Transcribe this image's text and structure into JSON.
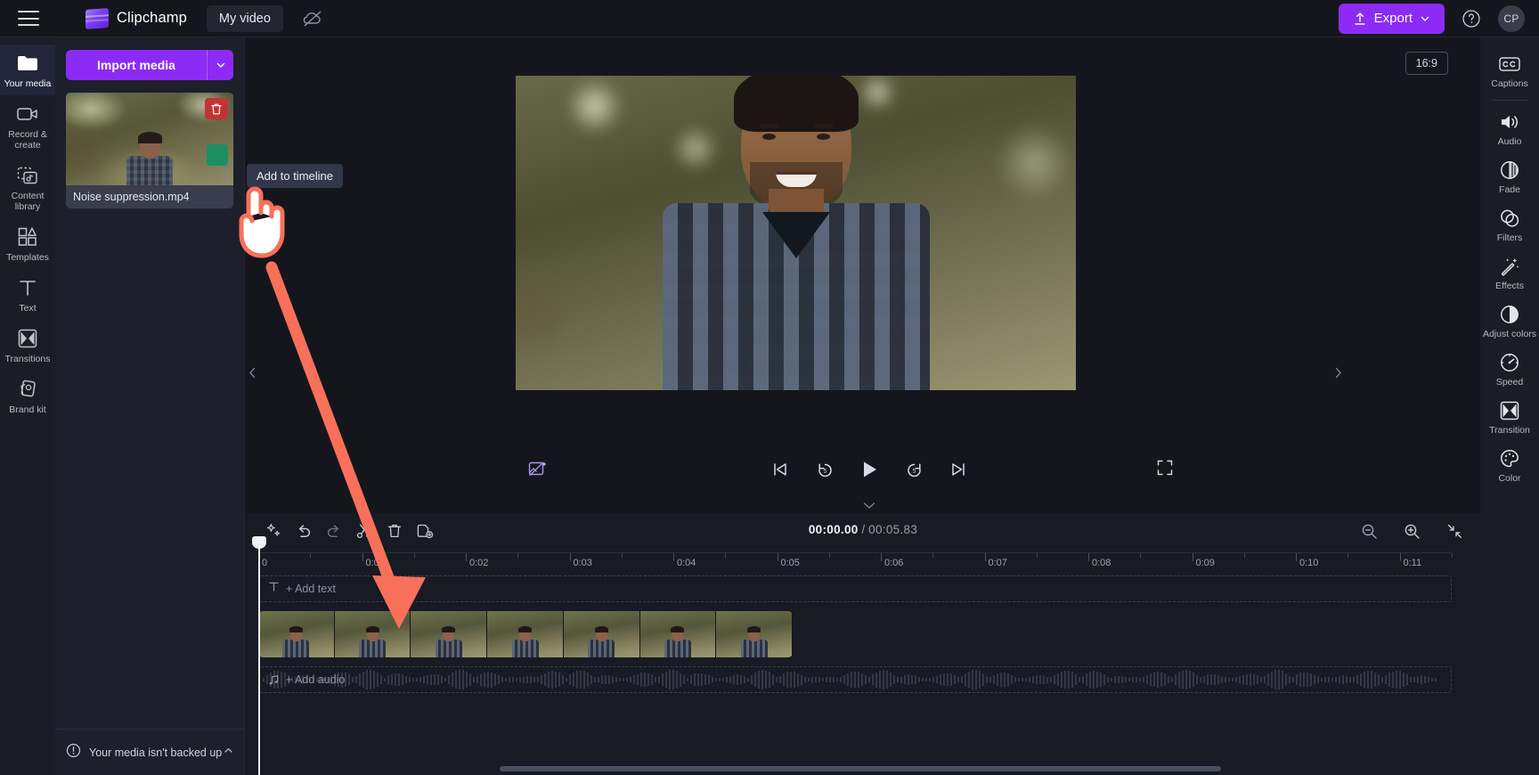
{
  "app": {
    "name": "Clipchamp",
    "project_title": "My video"
  },
  "header": {
    "menu_icon": "hamburger-icon",
    "logo_icon": "clipchamp-logo",
    "cloud_icon": "cloud-off-icon",
    "export_label": "Export",
    "export_icon": "upload-icon",
    "export_caret_icon": "chevron-down-icon",
    "help_icon": "help-circle-icon",
    "avatar_initials": "CP",
    "accent_color": "#8b2bf5"
  },
  "left_rail": {
    "items": [
      {
        "label": "Your media",
        "icon": "folder-icon",
        "active": true
      },
      {
        "label": "Record & create",
        "icon": "video-camera-icon",
        "active": false
      },
      {
        "label": "Content library",
        "icon": "content-library-icon",
        "active": false
      },
      {
        "label": "Templates",
        "icon": "templates-grid-icon",
        "active": false
      },
      {
        "label": "Text",
        "icon": "text-t-icon",
        "active": false
      },
      {
        "label": "Transitions",
        "icon": "transitions-icon",
        "active": false
      },
      {
        "label": "Brand kit",
        "icon": "brand-kit-icon",
        "active": false
      }
    ]
  },
  "media_panel": {
    "import_label": "Import media",
    "import_caret_icon": "chevron-down-icon",
    "item": {
      "name": "Noise suppression.mp4",
      "delete_icon": "trash-icon",
      "add_icon": "add-to-timeline-icon"
    },
    "tooltip": "Add to timeline",
    "backup_notice": "Your media isn't backed up",
    "backup_icon": "warning-circle-icon",
    "backup_caret_icon": "chevron-up-icon",
    "collapse_icon": "chevron-left-icon"
  },
  "preview": {
    "ratio_badge": "16:9",
    "controls": {
      "ai_icon": "magic-image-icon",
      "skip_start_icon": "skip-to-start-icon",
      "back5_icon": "rewind-5s-icon",
      "play_icon": "play-icon",
      "fwd5_icon": "forward-5s-icon",
      "skip_end_icon": "skip-to-end-icon",
      "fullscreen_icon": "fullscreen-icon"
    },
    "collapse_icon": "chevron-down-icon"
  },
  "right_rail": {
    "items": [
      {
        "label": "Captions",
        "icon": "closed-captions-icon"
      },
      {
        "label": "Audio",
        "icon": "speaker-icon"
      },
      {
        "label": "Fade",
        "icon": "fade-icon"
      },
      {
        "label": "Filters",
        "icon": "filters-icon"
      },
      {
        "label": "Effects",
        "icon": "effects-wand-icon"
      },
      {
        "label": "Adjust colors",
        "icon": "adjust-colors-icon"
      },
      {
        "label": "Speed",
        "icon": "speedometer-icon"
      },
      {
        "label": "Transition",
        "icon": "transition-icon"
      },
      {
        "label": "Color",
        "icon": "color-palette-icon"
      }
    ],
    "collapse_icon": "chevron-right-icon"
  },
  "timeline": {
    "toolbar": [
      {
        "name": "magic-tools",
        "icon": "sparkle-icon"
      },
      {
        "name": "undo",
        "icon": "undo-arrow-icon"
      },
      {
        "name": "redo",
        "icon": "redo-arrow-icon"
      },
      {
        "name": "split",
        "icon": "scissors-icon"
      },
      {
        "name": "delete",
        "icon": "trash-icon"
      },
      {
        "name": "duplicate",
        "icon": "duplicate-icon"
      }
    ],
    "current_time": "00:00.00",
    "separator": "/",
    "total_time": "00:05.83",
    "zoom_controls": [
      {
        "name": "zoom-out",
        "icon": "zoom-out-icon"
      },
      {
        "name": "zoom-in",
        "icon": "zoom-in-icon"
      },
      {
        "name": "fit-to-screen",
        "icon": "fit-screen-icon"
      }
    ],
    "ruler_ticks": [
      "0",
      "0:01",
      "0:02",
      "0:03",
      "0:04",
      "0:05",
      "0:06",
      "0:07",
      "0:08",
      "0:09",
      "0:10",
      "0:11"
    ],
    "text_track_label": "+ Add text",
    "text_track_icon": "text-t-icon",
    "audio_track_label": "+ Add audio",
    "audio_track_icon": "music-note-icon",
    "clip_speaker_icon": "speaker-icon"
  },
  "annotation": {
    "arrow_color": "#f9705a",
    "cursor_icon": "pointing-hand-cursor"
  }
}
